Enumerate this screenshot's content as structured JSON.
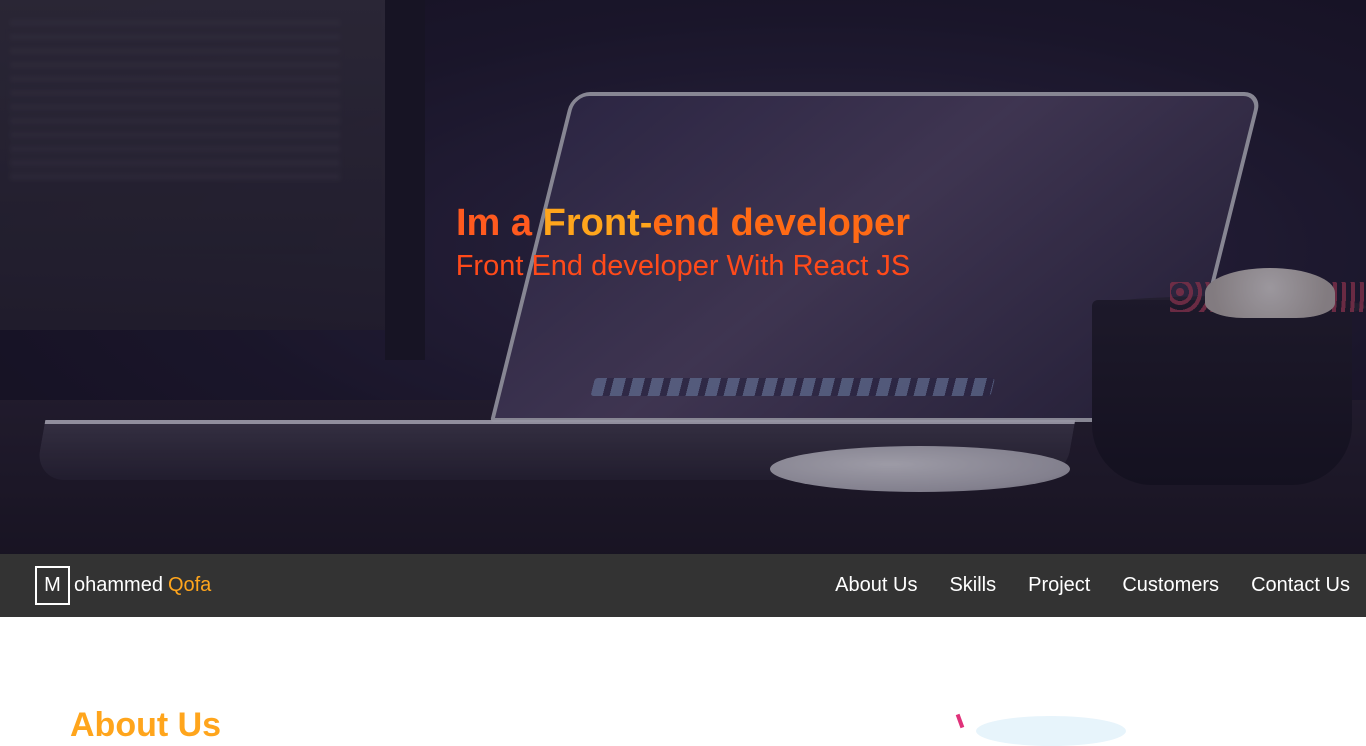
{
  "hero": {
    "title_part1": "Im a",
    "title_part2": "Front-",
    "title_part3": "end developer",
    "subtitle": "Front End developer With React JS"
  },
  "navbar": {
    "logo_letter": "M",
    "logo_rest": "ohammed",
    "logo_highlight": "Qofa",
    "links": [
      "About Us",
      "Skills",
      "Project",
      "Customers",
      "Contact Us"
    ]
  },
  "about": {
    "heading": "About Us"
  },
  "colors": {
    "accent_orange": "#ffa51c",
    "accent_red": "#ff5a1f",
    "navbar_bg": "#333333"
  }
}
